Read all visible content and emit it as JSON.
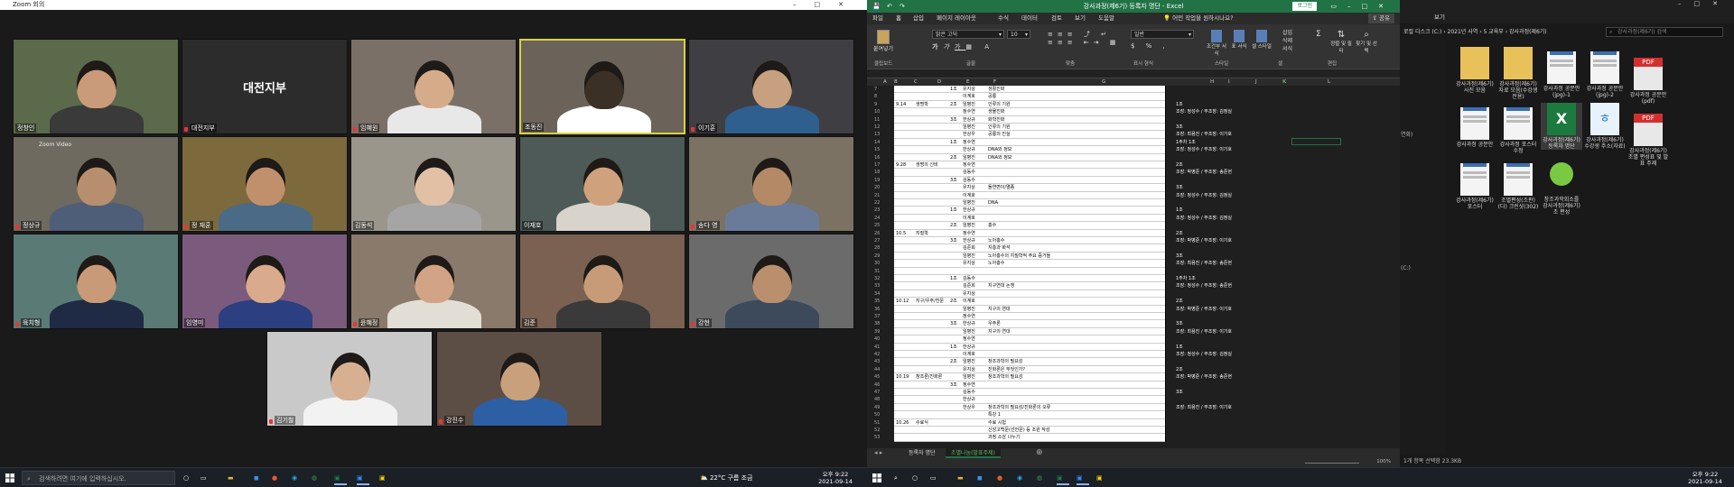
{
  "zoom": {
    "window_title": "Zoom 회의",
    "participants": [
      {
        "name": "정창인",
        "mic_muted": false
      },
      {
        "name": "대전지부",
        "mic_muted": true
      },
      {
        "name": "임혜원",
        "mic_muted": true
      },
      {
        "name": "조동진",
        "mic_muted": false
      },
      {
        "name": "이기훈",
        "mic_muted": true
      },
      {
        "name": "정상규",
        "mic_muted": true
      },
      {
        "name": "정 재훈",
        "mic_muted": true
      },
      {
        "name": "김동석",
        "mic_muted": false
      },
      {
        "name": "이재호",
        "mic_muted": false
      },
      {
        "name": "송다 영",
        "mic_muted": true
      },
      {
        "name": "육치형",
        "mic_muted": true
      },
      {
        "name": "임영미",
        "mic_muted": false
      },
      {
        "name": "윤혜정",
        "mic_muted": true
      },
      {
        "name": "김준",
        "mic_muted": false
      },
      {
        "name": "강현",
        "mic_muted": true
      },
      {
        "name": "김기철",
        "mic_muted": true
      },
      {
        "name": "강진수",
        "mic_muted": true
      }
    ],
    "center_tile_text": "대전지부",
    "tile_overlay": "Zoom Video"
  },
  "taskbar_left": {
    "search_placeholder": "검색하려면 여기에 입력하십시오.",
    "weather": "22°C 구름 조금",
    "time": "오후 9:22",
    "date": "2021-09-14"
  },
  "excel": {
    "title": "강사과정(제6기) 등록자 명단 - Excel",
    "login_button": "로그인",
    "share_button": "공유",
    "tabs": [
      "파일",
      "홈",
      "삽입",
      "페이지 레이아웃",
      "수식",
      "데이터",
      "검토",
      "보기",
      "도움말"
    ],
    "tell_me": "어떤 작업을 원하시나요?",
    "font_name": "맑은 고딕",
    "font_size": "10",
    "number_format": "일반",
    "ribbon_groups": [
      "클립보드",
      "글꼴",
      "맞춤",
      "표시 형식",
      "스타일",
      "셀",
      "편집"
    ],
    "ribbon_buttons": [
      "붙여넣기",
      "조건부 서식",
      "표 서식",
      "셀 스타일",
      "삽입",
      "삭제",
      "서식",
      "정렬 및 필터",
      "찾기 및 선택"
    ],
    "columns": [
      "A",
      "B",
      "C",
      "D",
      "E",
      "F",
      "G",
      "H",
      "I",
      "J",
      "K",
      "L"
    ],
    "selected_cell_column": "K",
    "rows": [
      {
        "n": "7",
        "d": "",
        "c": "",
        "e": "1조",
        "f": "유지상",
        "g": "생활진화",
        "h": ""
      },
      {
        "n": "8",
        "d": "",
        "c": "",
        "e": "",
        "f": "이계호",
        "g": "공룡",
        "h": ""
      },
      {
        "n": "9",
        "d": "9.14",
        "c": "생명학",
        "e": "2조",
        "f": "임병진",
        "g": "인류의 기원",
        "h": "1조"
      },
      {
        "n": "10",
        "d": "",
        "c": "",
        "e": "",
        "f": "정수연",
        "g": "생물진화",
        "h": "조장: 정성수 / 부조장: 김정실"
      },
      {
        "n": "11",
        "d": "",
        "c": "",
        "e": "3조",
        "f": "한상규",
        "g": "화학진화",
        "h": ""
      },
      {
        "n": "12",
        "d": "",
        "c": "",
        "e": "",
        "f": "임병진",
        "g": "인류의 기원",
        "h": "3조"
      },
      {
        "n": "13",
        "d": "",
        "c": "",
        "e": "",
        "f": "한상우",
        "g": "공룡의 진실",
        "h": "조장: 최용진 / 부조장: 이기호"
      },
      {
        "n": "14",
        "d": "",
        "c": "",
        "e": "1조",
        "f": "정수연",
        "g": "",
        "h": "1주차  1조"
      },
      {
        "n": "15",
        "d": "",
        "c": "",
        "e": "",
        "f": "한상규",
        "g": "DNA와 정보",
        "h": "조장: 정성수 / 부조장: 이기호"
      },
      {
        "n": "16",
        "d": "",
        "c": "",
        "e": "2조",
        "f": "임병진",
        "g": "DNA와 정보",
        "h": ""
      },
      {
        "n": "17",
        "d": "9.28",
        "c": "생명의 신비",
        "e": "",
        "f": "정수연",
        "g": "",
        "h": "2조"
      },
      {
        "n": "18",
        "d": "",
        "c": "",
        "e": "",
        "f": "김동수",
        "g": "",
        "h": "조장: 박병준 / 부조장: 송준현"
      },
      {
        "n": "19",
        "d": "",
        "c": "",
        "e": "3조",
        "f": "김동수",
        "g": "",
        "h": ""
      },
      {
        "n": "20",
        "d": "",
        "c": "",
        "e": "",
        "f": "유지상",
        "g": "돌연변이/멸종",
        "h": "3조"
      },
      {
        "n": "21",
        "d": "",
        "c": "",
        "e": "",
        "f": "이계호",
        "g": "",
        "h": "조장: 정성수 / 부조장: 김정실"
      },
      {
        "n": "22",
        "d": "",
        "c": "",
        "e": "",
        "f": "임병진",
        "g": "DNA",
        "h": ""
      },
      {
        "n": "23",
        "d": "",
        "c": "",
        "e": "1조",
        "f": "한상규",
        "g": "",
        "h": "1조"
      },
      {
        "n": "24",
        "d": "",
        "c": "",
        "e": "",
        "f": "이계호",
        "g": "",
        "h": "조장: 정성수 / 부조장: 김정실"
      },
      {
        "n": "25",
        "d": "",
        "c": "",
        "e": "2조",
        "f": "임병진",
        "g": "홍수",
        "h": ""
      },
      {
        "n": "26",
        "d": "10.5",
        "c": "지질학",
        "e": "",
        "f": "정수연",
        "g": "",
        "h": "2조"
      },
      {
        "n": "27",
        "d": "",
        "c": "",
        "e": "3조",
        "f": "한상규",
        "g": "노아홍수",
        "h": "조장: 박병준 / 부조장: 이기호"
      },
      {
        "n": "28",
        "d": "",
        "c": "",
        "e": "",
        "f": "김준희",
        "g": "지층과 화석",
        "h": ""
      },
      {
        "n": "29",
        "d": "",
        "c": "",
        "e": "",
        "f": "임병진",
        "g": "노아홍수의 지질학적 주요 증거들",
        "h": "3조"
      },
      {
        "n": "30",
        "d": "",
        "c": "",
        "e": "",
        "f": "유지상",
        "g": "노아홍수",
        "h": "조장: 최용진 / 부조장: 송준현"
      },
      {
        "n": "31",
        "d": "",
        "c": "",
        "e": "",
        "f": "",
        "g": "",
        "h": ""
      },
      {
        "n": "32",
        "d": "",
        "c": "",
        "e": "1조",
        "f": "김동수",
        "g": "",
        "h": "1주차  1조"
      },
      {
        "n": "33",
        "d": "",
        "c": "",
        "e": "",
        "f": "김준희",
        "g": "지구연대 논쟁",
        "h": "조장: 정성수 / 부조장: 송준현"
      },
      {
        "n": "34",
        "d": "",
        "c": "",
        "e": "",
        "f": "유지상",
        "g": "",
        "h": ""
      },
      {
        "n": "35",
        "d": "10.12",
        "c": "지구/우주/천문",
        "e": "2조",
        "f": "이계호",
        "g": "",
        "h": "2조"
      },
      {
        "n": "36",
        "d": "",
        "c": "",
        "e": "",
        "f": "임병진",
        "g": "지구의 연대",
        "h": "조장: 박병준 / 부조장: 이기호"
      },
      {
        "n": "37",
        "d": "",
        "c": "",
        "e": "",
        "f": "정수연",
        "g": "",
        "h": ""
      },
      {
        "n": "38",
        "d": "",
        "c": "",
        "e": "3조",
        "f": "한상규",
        "g": "우주론",
        "h": "3조"
      },
      {
        "n": "39",
        "d": "",
        "c": "",
        "e": "",
        "f": "임병진",
        "g": "지구의 연대",
        "h": "조장: 최용진 / 부조장: 이기호"
      },
      {
        "n": "40",
        "d": "",
        "c": "",
        "e": "",
        "f": "정수연",
        "g": "",
        "h": ""
      },
      {
        "n": "41",
        "d": "",
        "c": "",
        "e": "1조",
        "f": "한상규",
        "g": "",
        "h": "1조"
      },
      {
        "n": "42",
        "d": "",
        "c": "",
        "e": "",
        "f": "이계호",
        "g": "",
        "h": "조장: 정성수 / 부조장: 김정실"
      },
      {
        "n": "43",
        "d": "",
        "c": "",
        "e": "2조",
        "f": "임병진",
        "g": "창조과학의 필요성",
        "h": ""
      },
      {
        "n": "44",
        "d": "",
        "c": "",
        "e": "",
        "f": "유지상",
        "g": "진화론은 무엇인가?",
        "h": "2조"
      },
      {
        "n": "45",
        "d": "10.19",
        "c": "창조론/진화론",
        "e": "",
        "f": "임병진",
        "g": "창조과학의 필요성",
        "h": "조장: 박병준 / 부조장: 송준현"
      },
      {
        "n": "46",
        "d": "",
        "c": "",
        "e": "3조",
        "f": "정수연",
        "g": "",
        "h": ""
      },
      {
        "n": "47",
        "d": "",
        "c": "",
        "e": "",
        "f": "김동수",
        "g": "",
        "h": "3조"
      },
      {
        "n": "48",
        "d": "",
        "c": "",
        "e": "",
        "f": "한상규",
        "g": "",
        "h": ""
      },
      {
        "n": "49",
        "d": "",
        "c": "",
        "e": "",
        "f": "한상우",
        "g": "창조과학의 필요성/진화론의 오류",
        "h": "조장: 최용진 / 부조장: 이기호"
      },
      {
        "n": "50",
        "d": "",
        "c": "",
        "e": "",
        "f": "",
        "g": "특강 1",
        "h": ""
      },
      {
        "n": "51",
        "d": "10.26",
        "c": "수료식",
        "e": "",
        "f": "",
        "g": "수료 시험",
        "h": ""
      },
      {
        "n": "52",
        "d": "",
        "c": "",
        "e": "",
        "f": "",
        "g": "신앙고백문(선언문) 등 조원 작성",
        "h": ""
      },
      {
        "n": "53",
        "d": "",
        "c": "",
        "e": "",
        "f": "",
        "g": "과정 소감 나누기",
        "h": ""
      }
    ],
    "sheet_tabs": [
      "등록자 명단",
      "조별나눔(발표주제)"
    ],
    "active_sheet": 1,
    "zoom_level": "100%"
  },
  "explorer": {
    "breadcrumb": [
      "로컬 디스크 (C:)",
      "2021년 사역",
      "5 교육부",
      "강사과정(제6기)"
    ],
    "search_placeholder": "강사과정(제6기) 검색",
    "view_tab": "보기",
    "files": [
      {
        "label": "강사과정(제6기) 사진 모음",
        "type": "folder"
      },
      {
        "label": "강사과정(제6기) 자료 모음(수강생 전용)",
        "type": "folder"
      },
      {
        "label": "강사과정 공문안(jpg)-1",
        "type": "image"
      },
      {
        "label": "강사과정 공문안(jpg)-2",
        "type": "image"
      },
      {
        "label": "강사과정 공문안(pdf)",
        "type": "pdf"
      },
      {
        "label": "강사과정 공문안",
        "type": "image"
      },
      {
        "label": "강사과정 포스터 수정",
        "type": "image"
      },
      {
        "label": "강사과정(제6기) 등록자 명단",
        "type": "excel"
      },
      {
        "label": "강사과정(제6기) 수강생 주소(자료)",
        "type": "hwp"
      },
      {
        "label": "강사과정(제6기) 조별 편성표 및 발표 주제",
        "type": "pdf"
      },
      {
        "label": "강사과정(제6기) 포스터",
        "type": "image"
      },
      {
        "label": "조별편성(조판)(디) 크린샷(302)",
        "type": "image"
      },
      {
        "label": "창조과학회소를 강사과정(제6기) 조 편성",
        "type": "app"
      }
    ],
    "status_text": "1개 항목 선택함 23.3KB",
    "sidebar_text": "연화)"
  },
  "taskbar_right": {
    "time": "오후 9:22",
    "date": "2021-09-14"
  },
  "colors": {
    "excel_green": "#217346",
    "zoom_active": "#d7d33b",
    "taskbar": "#1b1f26"
  }
}
